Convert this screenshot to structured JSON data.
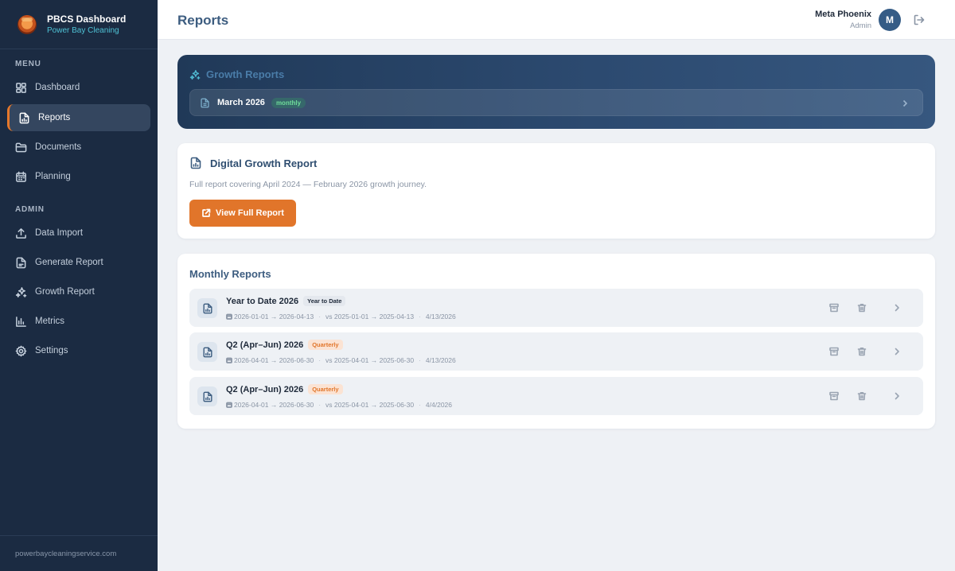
{
  "brand": {
    "title": "PBCS Dashboard",
    "subtitle": "Power Bay Cleaning"
  },
  "sidebar": {
    "menu_heading": "MENU",
    "admin_heading": "ADMIN",
    "items": [
      {
        "label": "Dashboard",
        "icon": "grid-icon"
      },
      {
        "label": "Reports",
        "icon": "file-chart-icon",
        "active": true
      },
      {
        "label": "Documents",
        "icon": "folder-icon"
      },
      {
        "label": "Planning",
        "icon": "calendar-icon"
      },
      {
        "label": "Data Import",
        "icon": "upload-icon"
      },
      {
        "label": "Generate Report",
        "icon": "file-add-icon"
      },
      {
        "label": "Growth Report",
        "icon": "sparkles-icon"
      },
      {
        "label": "Metrics",
        "icon": "bar-chart-icon"
      },
      {
        "label": "Settings",
        "icon": "gear-icon"
      }
    ],
    "footer": "powerbaycleaningservice.com"
  },
  "header": {
    "title": "Reports",
    "user_name": "Meta Phoenix",
    "user_role": "Admin",
    "avatar_initial": "M"
  },
  "growth": {
    "heading": "Growth Reports",
    "row_label": "March 2026",
    "row_tag": "monthly"
  },
  "digital": {
    "title": "Digital Growth Report",
    "description": "Full report covering April 2024 — February 2026 growth journey.",
    "button": "View Full Report"
  },
  "monthly": {
    "title": "Monthly Reports",
    "rows": [
      {
        "name": "Year to Date 2026",
        "tag": "Year to Date",
        "range": "2026-01-01 → 2026-04-13",
        "compare": "vs 2025-01-01 → 2025-04-13",
        "date": "4/13/2026"
      },
      {
        "name": "Q2 (Apr–Jun) 2026",
        "tag": "Quarterly",
        "range": "2026-04-01 → 2026-06-30",
        "compare": "vs 2025-04-01 → 2025-06-30",
        "date": "4/13/2026"
      },
      {
        "name": "Q2 (Apr–Jun) 2026",
        "tag": "Quarterly",
        "range": "2026-04-01 → 2026-06-30",
        "compare": "vs 2025-04-01 → 2025-06-30",
        "date": "4/4/2026"
      }
    ]
  },
  "colors": {
    "sidebar": "#1b2b42",
    "accent": "#e1752a",
    "title": "#3d5d80",
    "success": "#6fdc9a"
  }
}
